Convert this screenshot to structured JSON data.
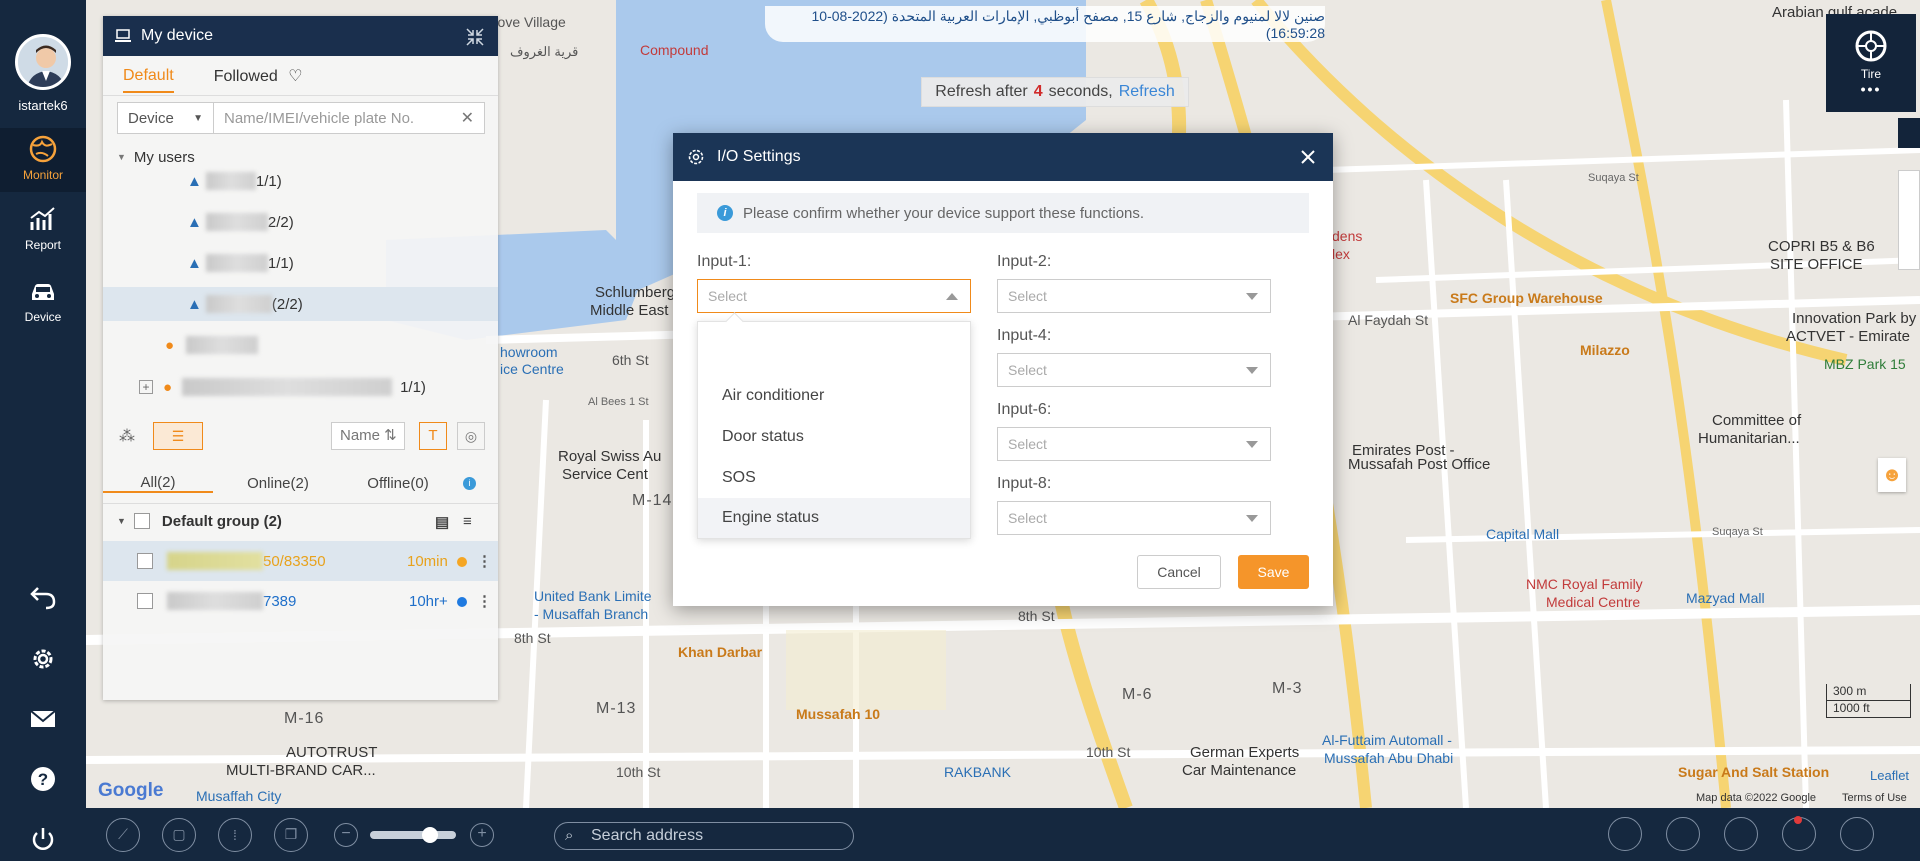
{
  "sidebar": {
    "username": "istartek6",
    "items": [
      {
        "label": "Monitor",
        "icon": "globe-icon",
        "active": true
      },
      {
        "label": "Report",
        "icon": "chart-icon",
        "active": false
      },
      {
        "label": "Device",
        "icon": "car-icon",
        "active": false
      }
    ],
    "bottom_icons": [
      "back-icon",
      "gear-icon",
      "mail-icon",
      "help-icon",
      "power-icon"
    ]
  },
  "device_panel": {
    "title": "My device",
    "tabs": [
      "Default",
      "Followed"
    ],
    "search_select": "Device",
    "search_placeholder": "Name/IMEI/vehicle plate No.",
    "tree_root": "My users",
    "tree_counts": [
      "1/1)",
      "2/2)",
      "1/1)",
      "(2/2)",
      "1/1)"
    ],
    "sort_label": "Name",
    "group_tabs": [
      "All(2)",
      "Online(2)",
      "Offline(0)"
    ],
    "group_name": "Default group (2)",
    "devices": [
      {
        "name_suffix": "50/83350",
        "status": "10min",
        "status_color": "#f5a623"
      },
      {
        "name_suffix": "7389",
        "status": "10hr+",
        "status_color": "#1f7ae0"
      }
    ]
  },
  "top_info": "صنين لالا لمنيوم والزجاج, شارع 15, مصفح أبوظبي, الإمارات العربية المتحدة (2022-08-10 16:59:28)",
  "refresh_bar": {
    "prefix": "Refresh after",
    "seconds": "4",
    "suffix": "seconds,",
    "link": "Refresh"
  },
  "tire_panel": {
    "label": "Tire"
  },
  "map": {
    "labels": {
      "grove_village": "Grove Village",
      "grove_village_ar": "قرية الغروف",
      "compound": "Compound",
      "schlumberger": "Schlumberger",
      "middle_east": "Middle East",
      "showroom": "howroom",
      "ice_centre": "ice Centre",
      "sixth_st": "6th St",
      "al_bees_1": "Al Bees 1 St",
      "royal_swiss": "Royal Swiss Au",
      "service_centre": "Service Cent",
      "m14": "M-14",
      "united_bank": "United Bank Limite",
      "musaffah_branch": "- Musaffah Branch",
      "eighth_st": "8th St",
      "khan_darbar": "Khan Darbar",
      "m16": "M-16",
      "m13": "M-13",
      "autotrust": "AUTOTRUST",
      "multi_brand": "MULTI-BRAND CAR...",
      "musaffah_city": "Musaffah City",
      "tenth_st": "10th St",
      "musaffah_10": "Mussafah 10",
      "rakbank": "RAKBANK",
      "german_experts": "German Experts",
      "car_maintenance": "Car Maintenance",
      "al_futtaim": "Al-Futtaim Automall -",
      "mussafah_abu_dhabi": "Mussafah Abu Dhabi",
      "emirates_post": "Emirates Post -",
      "mussafah_post": "Mussafah Post Office",
      "capital_mall": "Capital Mall",
      "nmc": "NMC Royal Family",
      "medical_centre": "Medical Centre",
      "mazyad_mall": "Mazyad Mall",
      "sfc": "SFC Group Warehouse",
      "milazzo": "Milazzo",
      "copri": "COPRI B5 & B6",
      "site_office": "SITE OFFICE",
      "innovation_park": "Innovation Park by",
      "actvet": "ACTVET - Emirate",
      "mbz_park": "MBZ Park 15",
      "committee": "Committee of",
      "humanitarian": "Humanitarian...",
      "al_faydah": "Al Faydah St",
      "suqaya": "Suqaya St",
      "sugar_salt": "Sugar And Salt Station",
      "m6": "M-6",
      "m3": "M-3",
      "arabian_gulf": "Arabian gulf acade",
      "google": "Google",
      "map_data": "Map data ©2022 Google",
      "terms": "Terms of Use",
      "leaflet": "Leaflet",
      "scale_m": "300 m",
      "scale_ft": "1000 ft",
      "dens": "dens",
      "lex": "lex"
    }
  },
  "bottom_bar": {
    "search_placeholder": "Search address"
  },
  "modal": {
    "title": "I/O Settings",
    "notice": "Please confirm whether your device support these functions.",
    "inputs": [
      {
        "label": "Input-1:",
        "value": "Select"
      },
      {
        "label": "Input-2:",
        "value": "Select"
      },
      {
        "label": "Input-4:",
        "value": "Select"
      },
      {
        "label": "Input-6:",
        "value": "Select"
      },
      {
        "label": "Input-8:",
        "value": "Select"
      }
    ],
    "dropdown_options": [
      "Air conditioner",
      "Door status",
      "SOS",
      "Engine status"
    ],
    "cancel_label": "Cancel",
    "save_label": "Save"
  }
}
